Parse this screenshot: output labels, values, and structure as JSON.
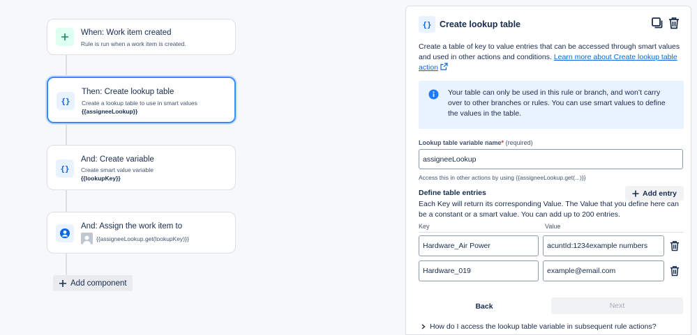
{
  "flow": {
    "trigger": {
      "title": "When: Work item created",
      "subtitle": "Rule is run when a work item is created."
    },
    "step1": {
      "title": "Then: Create lookup table",
      "subtitle": "Create a lookup table to use in smart values",
      "code": "{{assigneeLookup}}"
    },
    "step2": {
      "title": "And: Create variable",
      "subtitle": "Create smart value variable",
      "code": "{{lookupKey}}"
    },
    "step3": {
      "title": "And: Assign the work item to",
      "code": "{{assigneeLookup.get(lookupKey)}}"
    },
    "add_component": "Add component"
  },
  "panel": {
    "title": "Create lookup table",
    "description": "Create a table of key to value entries that can be accessed through smart values and used in other actions and conditions.",
    "learn_more": "Learn more about Create lookup table action",
    "info": "Your table can only be used in this rule or branch, and won’t carry over to other branches or rules. You can use smart values to define the values in the table.",
    "var_label": "Lookup table variable name",
    "var_required_mark": "*",
    "var_required_text": "(required)",
    "var_value": "assigneeLookup",
    "var_help": "Access this in other actions by using {{assigneeLookup.get(...)}}",
    "define_title": "Define table entries",
    "add_entry": "Add entry",
    "define_desc": "Each Key will return its corresponding Value. The Value that you define here can be a constant or a smart value. You can add up to 200 entries.",
    "key_header": "Key",
    "value_header": "Value",
    "entries": [
      {
        "key": "Hardware_Air Power",
        "value": "acuntId:1234example numbers"
      },
      {
        "key": "Hardware_019",
        "value": "example@email.com"
      }
    ],
    "back": "Back",
    "next": "Next",
    "faq": "How do I access the lookup table variable in subsequent rule actions?"
  },
  "colors": {
    "accent": "#0c66e4",
    "selected_border": "#388bff",
    "info_bg": "#e9f2ff",
    "trigger_icon_bg": "#dcfff1"
  },
  "icons": [
    "plus-icon",
    "braces-icon",
    "user-circle-icon",
    "copy-icon",
    "trash-icon",
    "info-icon",
    "external-link-icon",
    "chevron-right-icon",
    "avatar-icon"
  ]
}
